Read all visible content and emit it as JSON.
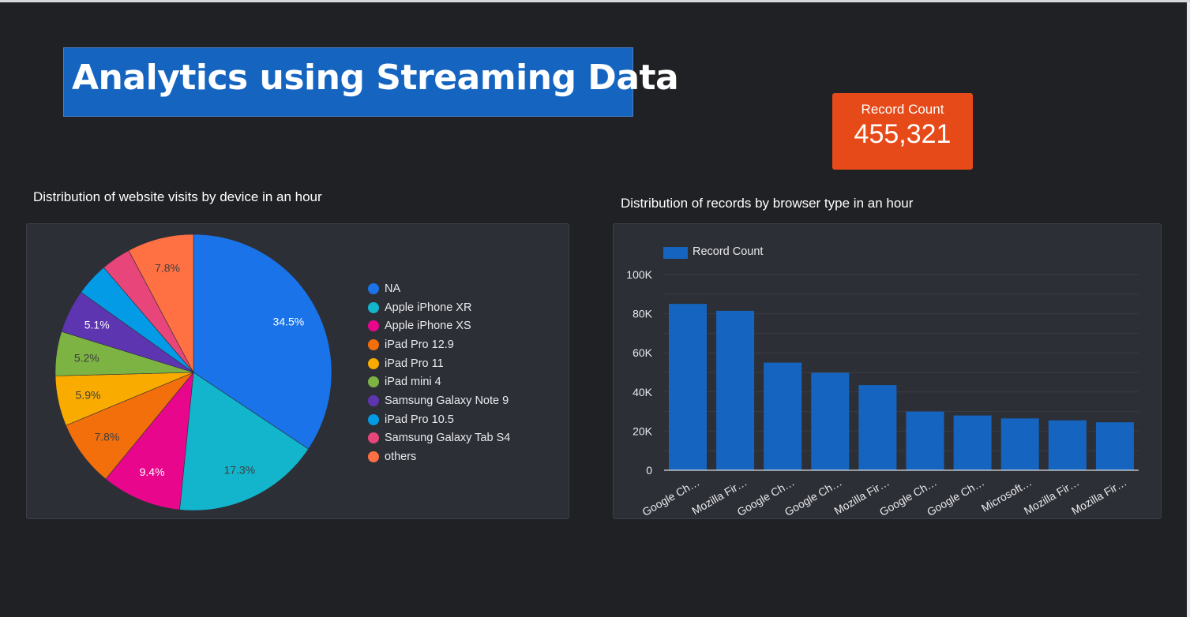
{
  "dashboard": {
    "title": "Analytics using Streaming Data"
  },
  "scorecard": {
    "label": "Record Count",
    "value": "455,321",
    "color": "#e64a19"
  },
  "pie_chart": {
    "title": "Distribution of website visits by device in an hour"
  },
  "bar_chart": {
    "title": "Distribution of records by browser type in an hour",
    "legend_label": "Record Count",
    "color": "#1565c0"
  },
  "chart_data": [
    {
      "type": "pie",
      "title": "Distribution of website visits by device in an hour",
      "legend_position": "right",
      "slices": [
        {
          "label": "NA",
          "value": 34.5,
          "value_label": "34.5%",
          "color": "#1a73e8"
        },
        {
          "label": "Apple iPhone XR",
          "value": 17.3,
          "value_label": "17.3%",
          "color": "#12b5cb"
        },
        {
          "label": "Apple iPhone XS",
          "value": 9.4,
          "value_label": "9.4%",
          "color": "#e8078c"
        },
        {
          "label": "iPad Pro 12.9",
          "value": 7.8,
          "value_label": "7.8%",
          "color": "#f26f0b"
        },
        {
          "label": "iPad Pro 11",
          "value": 5.9,
          "value_label": "5.9%",
          "color": "#f9ab00"
        },
        {
          "label": "iPad mini 4",
          "value": 5.2,
          "value_label": "5.2%",
          "color": "#7cb342"
        },
        {
          "label": "Samsung Galaxy Note 9",
          "value": 5.1,
          "value_label": "5.1%",
          "color": "#5e35b1"
        },
        {
          "label": "iPad Pro 10.5",
          "value": 3.9,
          "value_label": "",
          "color": "#039be5"
        },
        {
          "label": "Samsung Galaxy Tab S4",
          "value": 3.5,
          "value_label": "",
          "color": "#e8457a"
        },
        {
          "label": "others",
          "value": 7.8,
          "value_label": "7.8%",
          "color": "#ff7043"
        }
      ]
    },
    {
      "type": "bar",
      "title": "Distribution of records by browser type in an hour",
      "legend_position": "top-left",
      "categories": [
        "Google Ch…",
        "Mozilla Fir…",
        "Google Ch…",
        "Google Ch…",
        "Mozilla Fir…",
        "Google Ch…",
        "Google Ch…",
        "Microsoft…",
        "Mozilla Fir…",
        "Mozilla Fir…"
      ],
      "series": [
        {
          "name": "Record Count",
          "values": [
            85000,
            81500,
            55000,
            49800,
            43500,
            30000,
            28000,
            26500,
            25500,
            24500
          ]
        }
      ],
      "y_ticks": [
        "0",
        "20K",
        "40K",
        "60K",
        "80K",
        "100K"
      ],
      "ylim": [
        0,
        100000
      ],
      "grid": true
    }
  ]
}
